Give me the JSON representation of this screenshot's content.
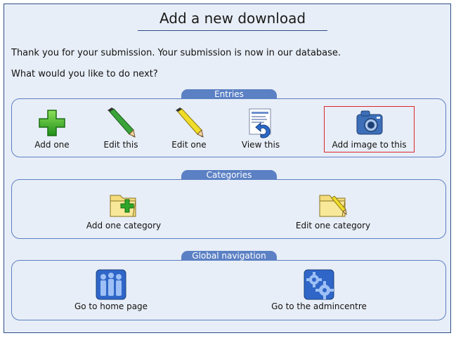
{
  "page": {
    "title": "Add a new download",
    "message_1": "Thank you for your submission. Your submission is now in our database.",
    "message_2": "What would you like to do next?"
  },
  "entries": {
    "legend": "Entries",
    "items": [
      {
        "label": "Add one",
        "icon": "plus-icon"
      },
      {
        "label": "Edit this",
        "icon": "green-pencil-icon"
      },
      {
        "label": "Edit one",
        "icon": "yellow-pencil-icon"
      },
      {
        "label": "View this",
        "icon": "view-page-icon"
      },
      {
        "label": "Add image to this",
        "icon": "camera-icon"
      }
    ]
  },
  "categories": {
    "legend": "Categories",
    "items": [
      {
        "label": "Add one category",
        "icon": "folder-add-icon"
      },
      {
        "label": "Edit one category",
        "icon": "folder-edit-icon"
      }
    ]
  },
  "navigation": {
    "legend": "Global navigation",
    "items": [
      {
        "label": "Go to home page",
        "icon": "people-icon"
      },
      {
        "label": "Go to the admincentre",
        "icon": "gears-icon"
      }
    ]
  },
  "colors": {
    "accent": "#5b80c4",
    "border": "#2d4f8a",
    "background": "#e8eef7",
    "highlight": "#d9262d"
  }
}
